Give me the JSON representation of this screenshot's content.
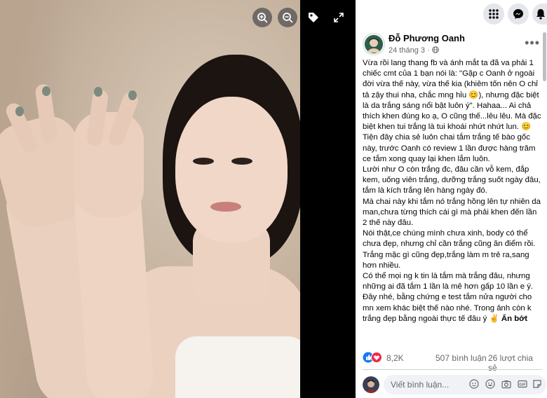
{
  "post": {
    "author": "Đỗ Phương Oanh",
    "date": "24 tháng 3",
    "date_separator": "·",
    "paragraphs": [
      "Vừa rồi lang thang fb và ánh mắt ta đã va phải 1 chiếc cmt của 1 bạn nói là: \"Gặp c Oanh ở ngoài đời vừa thế này, vừa thế kia (khiêm tốn nên O chỉ tả zậy thui nha, chắc mng hỉu 😊), nhưng đặc biệt là da trắng sáng nổi bật luôn ý\". Hahaa... Ai chả thích khen đúng ko ạ, O cũng thế...lêu lêu. Mà đặc biệt khen tui trắng là tui khoái nhứt nhứt lun. 😊",
      "Tiện đây chia sẻ luôn chai tắm trắng tế bào gốc này, trước Oanh có review 1 lần được hàng trăm ce tắm xong quay lại khen lắm luôn.",
      "Lười như O còn trắng đc, đâu cần vỗ kem, đắp kem, uống viên trắng, dưỡng trắng suốt ngày đâu, tắm là kích trắng lên hàng ngày đó.",
      "Mà chai này khi tắm nó trắng hồng lên tự nhiên da man,chưa từng thích cái gì mà phải khen đến lần 2 thế này đâu.",
      "Nói thật,ce chúng mình chưa xinh, body có thể chưa đẹp, nhưng chỉ cần trắng cũng ăn điểm rồi. Trắng mặc gì cũng đẹp,trắng làm m trẻ ra,sang hơn nhiều.",
      "Có thể mọi ng k tin là tắm mà trắng đâu, nhưng những ai đã tắm 1 lần là mê hơn gấp 10 lần e ý. Đây nhé, bằng chứng e test tắm nửa người cho mn xem khác biệt thế nào nhé. Trong ảnh còn k trắng đẹp bằng ngoài thực tế đâu ý ✌"
    ],
    "see_less": "Ẩn bớt",
    "more_icon": "•••"
  },
  "stats": {
    "reactions": "8,2K",
    "comments": "507 bình luận",
    "shares": "26 lượt chia sẻ"
  },
  "comment": {
    "placeholder": "Viết bình luận..."
  },
  "colors": {
    "like_blue": "#1877f2",
    "love_red": "#f02849",
    "text_secondary": "#65676b"
  },
  "icons": {
    "zoom_in": "zoom-in-icon",
    "zoom_out": "zoom-out-icon",
    "tag": "tag-icon",
    "fullscreen": "fullscreen-icon",
    "menu": "menu-grid-icon",
    "messenger": "messenger-icon",
    "notifications": "bell-icon",
    "globe": "globe-icon"
  }
}
